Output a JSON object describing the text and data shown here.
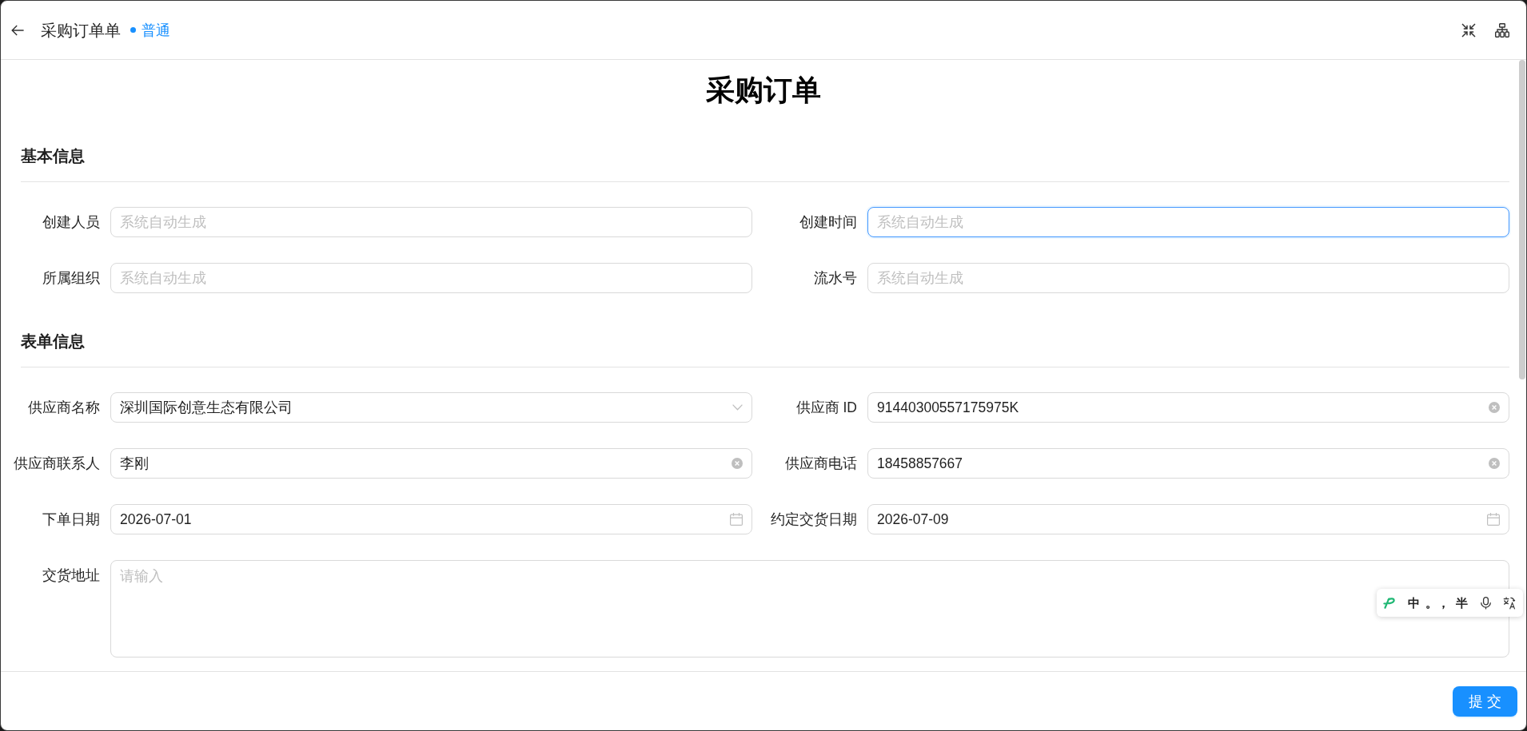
{
  "header": {
    "title": "采购订单单",
    "status": "普通"
  },
  "form": {
    "title": "采购订单",
    "sections": [
      {
        "title": "基本信息",
        "fields": [
          {
            "label": "创建人员",
            "kind": "text",
            "placeholder": "系统自动生成",
            "focused": false,
            "clearable": false
          },
          {
            "label": "创建时间",
            "kind": "text",
            "placeholder": "系统自动生成",
            "focused": true,
            "clearable": false
          },
          {
            "label": "所属组织",
            "kind": "text",
            "placeholder": "系统自动生成",
            "focused": false,
            "clearable": false
          },
          {
            "label": "流水号",
            "kind": "text",
            "placeholder": "系统自动生成",
            "focused": false,
            "clearable": false
          }
        ]
      },
      {
        "title": "表单信息",
        "fields": [
          {
            "label": "供应商名称",
            "kind": "select",
            "value": "深圳国际创意生态有限公司",
            "focused": false,
            "clearable": false
          },
          {
            "label": "供应商 ID",
            "kind": "text",
            "value": "91440300557175975K",
            "focused": false,
            "clearable": true
          },
          {
            "label": "供应商联系人",
            "kind": "text",
            "value": "李刚",
            "focused": false,
            "clearable": true
          },
          {
            "label": "供应商电话",
            "kind": "text",
            "value": "18458857667",
            "focused": false,
            "clearable": true
          },
          {
            "label": "下单日期",
            "kind": "date",
            "value": "2026-07-01",
            "focused": false,
            "clearable": false
          },
          {
            "label": "约定交货日期",
            "kind": "date",
            "value": "2026-07-09",
            "focused": false,
            "clearable": false
          },
          {
            "label": "交货地址",
            "kind": "textarea",
            "placeholder": "请输入",
            "focused": false,
            "clearable": false
          }
        ]
      }
    ]
  },
  "footer": {
    "submit": "提 交"
  },
  "ime_toolbar": {
    "items": [
      {
        "kind": "logo"
      },
      {
        "kind": "toggle",
        "label": "中"
      },
      {
        "kind": "toggle",
        "label": "。，"
      },
      {
        "kind": "toggle",
        "label": "半"
      },
      {
        "kind": "mic"
      },
      {
        "kind": "translate"
      }
    ]
  }
}
